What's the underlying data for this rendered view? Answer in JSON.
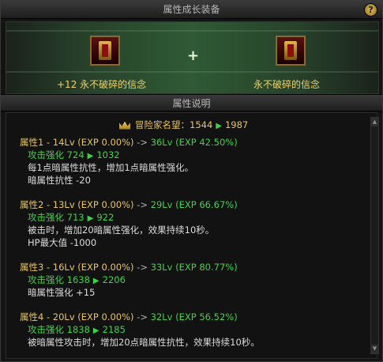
{
  "window": {
    "title": "属性成长装备",
    "help_label": "?"
  },
  "equip": {
    "left_caption": "+12 永不破碎的信念",
    "right_caption": "永不破碎的信念",
    "plus_glyph": "+"
  },
  "section": {
    "title": "属性说明"
  },
  "fame": {
    "label": "冒险家名望：1544",
    "to": "1987"
  },
  "attrs": [
    {
      "head": "属性1 - 14Lv (EXP 0.00%)",
      "arrow": "->",
      "target": "36Lv (EXP 42.50%)",
      "stat_label": "攻击强化 724",
      "stat_to": "1032",
      "desc": [
        "每1点暗属性抗性，增加1点暗属性强化。",
        "暗属性抗性 -20"
      ]
    },
    {
      "head": "属性2 - 13Lv (EXP 0.00%)",
      "arrow": "->",
      "target": "29Lv (EXP 66.67%)",
      "stat_label": "攻击强化 713",
      "stat_to": "922",
      "desc": [
        "被击时，增加20暗属性强化，效果持续10秒。",
        "HP最大值 -1000"
      ]
    },
    {
      "head": "属性3 - 16Lv (EXP 0.00%)",
      "arrow": "->",
      "target": "33Lv (EXP 80.77%)",
      "stat_label": "攻击强化 1638",
      "stat_to": "2206",
      "desc": [
        "暗属性强化 +15"
      ]
    },
    {
      "head": "属性4 - 20Lv (EXP 0.00%)",
      "arrow": "->",
      "target": "32Lv (EXP 56.52%)",
      "stat_label": "攻击强化 1838",
      "stat_to": "2185",
      "desc": [
        "被暗属性攻击时，增加20点暗属性抗性，效果持续10秒。"
      ]
    }
  ]
}
